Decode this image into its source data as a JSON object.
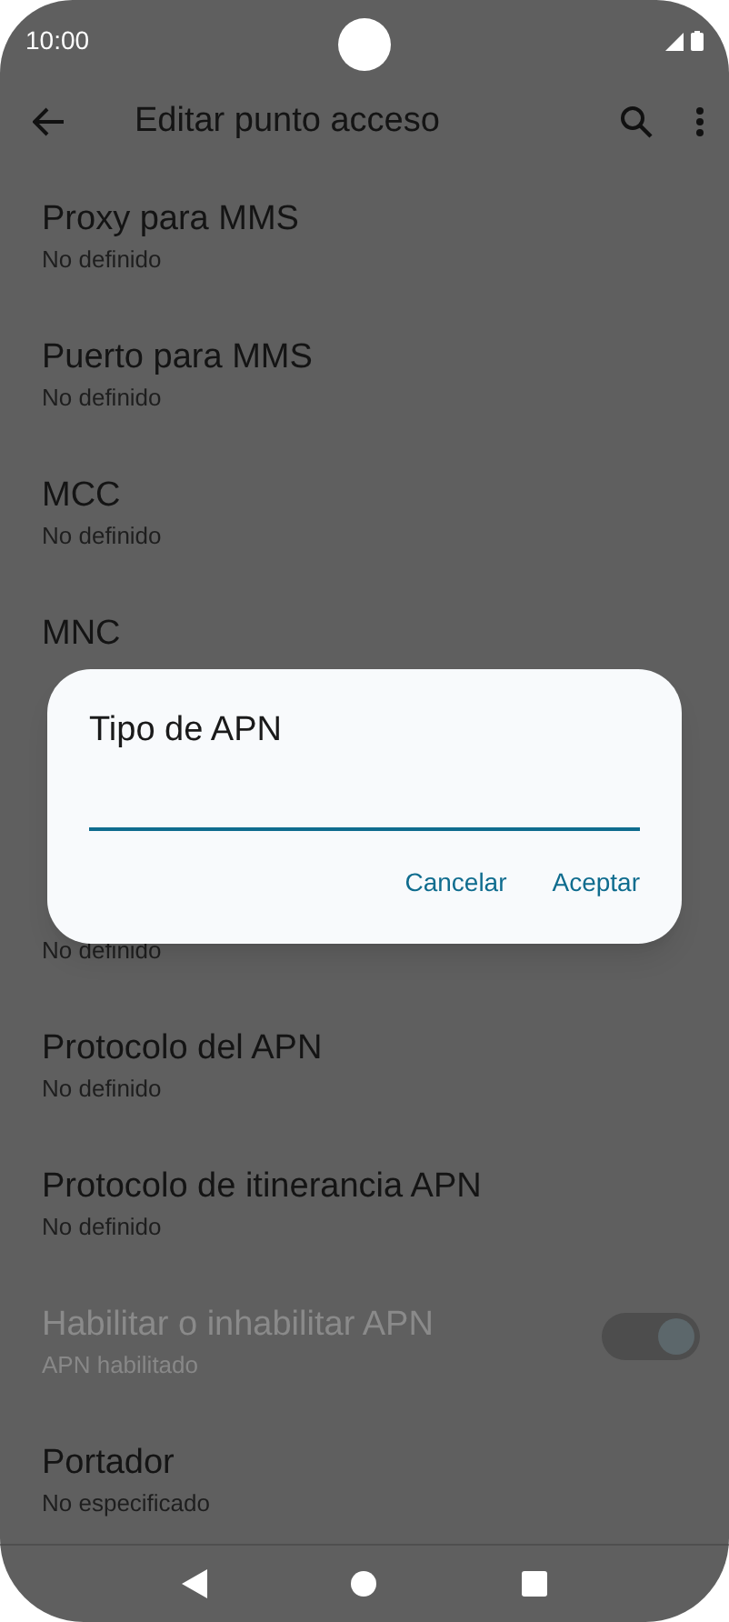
{
  "status_bar": {
    "time": "10:00"
  },
  "app_bar": {
    "title": "Editar punto acceso"
  },
  "items": [
    {
      "kind": "text",
      "title": "Proxy para MMS",
      "subtitle": "No definido",
      "disabled": false
    },
    {
      "kind": "text",
      "title": "Puerto para MMS",
      "subtitle": "No definido",
      "disabled": false
    },
    {
      "kind": "text",
      "title": "MCC",
      "subtitle": "No definido",
      "disabled": false
    },
    {
      "kind": "text",
      "title": "MNC",
      "disabled": false
    },
    {
      "kind": "text"
    },
    {
      "kind": "text",
      "subtitle": "No definido",
      "disabled": false
    },
    {
      "kind": "text",
      "title": "Protocolo del APN",
      "subtitle": "No definido",
      "disabled": false
    },
    {
      "kind": "text",
      "title": "Protocolo de itinerancia APN",
      "subtitle": "No definido",
      "disabled": false
    },
    {
      "kind": "switch",
      "title": "Habilitar o inhabilitar APN",
      "subtitle": "APN habilitado",
      "disabled": true,
      "on": true
    },
    {
      "kind": "text",
      "title": "Portador",
      "subtitle": "No especificado",
      "disabled": false
    }
  ],
  "dialog": {
    "title": "Tipo de APN",
    "buttons": [
      "Cancelar",
      "Aceptar"
    ]
  }
}
